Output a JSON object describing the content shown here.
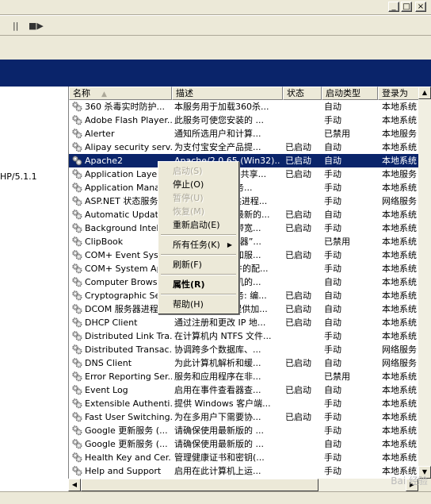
{
  "window": {
    "minimize_glyph": "_",
    "maximize_glyph": "□",
    "close_glyph": "×"
  },
  "toolbar": {
    "pause_glyph": "||",
    "restart_glyph": "■▶"
  },
  "left_pane": {
    "fragment": "HP/5.1.1"
  },
  "columns": [
    "名称",
    "描述",
    "状态",
    "启动类型",
    "登录为"
  ],
  "rows": [
    {
      "name": "360 杀毒实时防护...",
      "desc": "本服务用于加载360杀...",
      "status": "",
      "startup": "自动",
      "logon": "本地系统"
    },
    {
      "name": "Adobe Flash Player...",
      "desc": "此服务可使您安装的 ...",
      "status": "",
      "startup": "手动",
      "logon": "本地系统"
    },
    {
      "name": "Alerter",
      "desc": "通知所选用户和计算...",
      "status": "",
      "startup": "已禁用",
      "logon": "本地服务"
    },
    {
      "name": "Alipay security serv...",
      "desc": "为支付宝安全产品提...",
      "status": "已启动",
      "startup": "自动",
      "logon": "本地系统"
    },
    {
      "name": "Apache2",
      "desc": "Apache/2.0.65 (Win32)...",
      "status": "已启动",
      "startup": "自动",
      "logon": "本地系统"
    },
    {
      "name": "Application Layer G...",
      "desc": "为 Internet 连接共享...",
      "status": "已启动",
      "startup": "手动",
      "logon": "本地服务"
    },
    {
      "name": "Application Manage...",
      "desc": "提供软件安装服务...",
      "status": "",
      "startup": "手动",
      "logon": "本地系统"
    },
    {
      "name": "ASP.NET 状态服务",
      "desc": "为 ASP.NET 提供进程...",
      "status": "",
      "startup": "手动",
      "logon": "网络服务"
    },
    {
      "name": "Automatic Updates",
      "desc": "允许下载并安装最新的...",
      "status": "已启动",
      "startup": "自动",
      "logon": "本地系统"
    },
    {
      "name": "Background Intellig...",
      "desc": "利用空闲的网络带宽...",
      "status": "已启动",
      "startup": "手动",
      "logon": "本地系统"
    },
    {
      "name": "ClipBook",
      "desc": "启用“剪贴簿查看器”...",
      "status": "",
      "startup": "已禁用",
      "logon": "本地系统"
    },
    {
      "name": "COM+ Event System",
      "desc": "支持系统事件通知服...",
      "status": "已启动",
      "startup": "手动",
      "logon": "本地系统"
    },
    {
      "name": "COM+ System Appli...",
      "desc": "管理 COM+ 组件的配...",
      "status": "",
      "startup": "手动",
      "logon": "本地系统"
    },
    {
      "name": "Computer Browser",
      "desc": "维护网络上计算机的...",
      "status": "",
      "startup": "自动",
      "logon": "本地系统"
    },
    {
      "name": "Cryptographic Servi...",
      "desc": "提供三种管理服务: 编...",
      "status": "已启动",
      "startup": "自动",
      "logon": "本地系统"
    },
    {
      "name": "DCOM 服务器进程...",
      "desc": "为 DCOM 服务提供加...",
      "status": "已启动",
      "startup": "自动",
      "logon": "本地系统"
    },
    {
      "name": "DHCP Client",
      "desc": "通过注册和更改 IP 地...",
      "status": "已启动",
      "startup": "自动",
      "logon": "本地系统"
    },
    {
      "name": "Distributed Link Tra...",
      "desc": "在计算机内 NTFS 文件...",
      "status": "",
      "startup": "手动",
      "logon": "本地系统"
    },
    {
      "name": "Distributed Transac...",
      "desc": "协调跨多个数据库、...",
      "status": "",
      "startup": "手动",
      "logon": "网络服务"
    },
    {
      "name": "DNS Client",
      "desc": "为此计算机解析和缓...",
      "status": "已启动",
      "startup": "自动",
      "logon": "网络服务"
    },
    {
      "name": "Error Reporting Ser...",
      "desc": "服务和应用程序在非...",
      "status": "",
      "startup": "已禁用",
      "logon": "本地系统"
    },
    {
      "name": "Event Log",
      "desc": "启用在事件查看器查...",
      "status": "已启动",
      "startup": "自动",
      "logon": "本地系统"
    },
    {
      "name": "Extensible Authenti...",
      "desc": "提供 Windows 客户端...",
      "status": "",
      "startup": "手动",
      "logon": "本地系统"
    },
    {
      "name": "Fast User Switching...",
      "desc": "为在多用户下需要协...",
      "status": "已启动",
      "startup": "手动",
      "logon": "本地系统"
    },
    {
      "name": "Google 更新服务 (...",
      "desc": "请确保使用最新版的 ...",
      "status": "",
      "startup": "手动",
      "logon": "本地系统"
    },
    {
      "name": "Google 更新服务 (...",
      "desc": "请确保使用最新版的 ...",
      "status": "",
      "startup": "自动",
      "logon": "本地系统"
    },
    {
      "name": "Health Key and Cer...",
      "desc": "管理健康证书和密钥(...",
      "status": "",
      "startup": "手动",
      "logon": "本地系统"
    },
    {
      "name": "Help and Support",
      "desc": "启用在此计算机上运...",
      "status": "",
      "startup": "手动",
      "logon": "本地系统"
    }
  ],
  "selected_row": 4,
  "context_menu": {
    "items": [
      {
        "label": "启动(S)",
        "disabled": true
      },
      {
        "label": "停止(O)",
        "disabled": false
      },
      {
        "label": "暂停(U)",
        "disabled": true
      },
      {
        "label": "恢复(M)",
        "disabled": true
      },
      {
        "label": "重新启动(E)",
        "disabled": false
      },
      {
        "sep": true
      },
      {
        "label": "所有任务(K)",
        "disabled": false,
        "submenu": true
      },
      {
        "sep": true
      },
      {
        "label": "刷新(F)",
        "disabled": false
      },
      {
        "sep": true
      },
      {
        "label": "属性(R)",
        "disabled": false,
        "bold": true
      },
      {
        "sep": true
      },
      {
        "label": "帮助(H)",
        "disabled": false
      }
    ]
  },
  "scroll": {
    "up": "▲",
    "down": "▼",
    "left": "◀",
    "right": "▶"
  },
  "watermark": "Bai 经验"
}
